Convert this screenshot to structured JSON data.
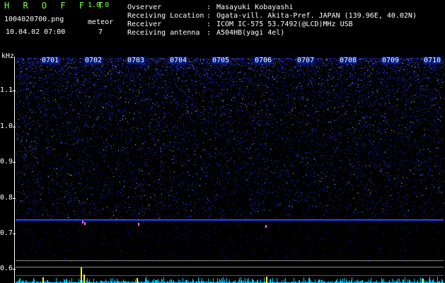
{
  "header": {
    "app_title": "H R O F F T",
    "version": "1.0.0",
    "filename": "1004020700.png",
    "datetime": "10.04.02 07:00",
    "meteor_label": "meteor",
    "meteor_count": "7"
  },
  "station": {
    "rows": [
      {
        "key": "Ovserver",
        "value": "Masayuki Kobayashi"
      },
      {
        "key": "Receiving Location",
        "value": "Ogata-vill. Akita-Pref. JAPAN (139.96E, 40.02N)"
      },
      {
        "key": "Receiver",
        "value": "ICOM IC-575 53.7492(@LCD)MHz USB"
      },
      {
        "key": "Receiving antenna",
        "value": "A504HB(yagi 4el)"
      }
    ]
  },
  "spectrogram": {
    "y_unit": "kHz",
    "y_ticks": [
      "1.1",
      "1.0",
      "0.9",
      "0.8",
      "0.7",
      "0.6"
    ],
    "time_labels": [
      "0701",
      "0702",
      "0703",
      "0704",
      "0705",
      "0706",
      "0707",
      "0708",
      "0709",
      "0710"
    ],
    "colors": {
      "background": "#000000",
      "noise": "#1a2cff",
      "trace": "#00ffff",
      "meteor": "#ffff00",
      "title": "#7cff4a"
    }
  }
}
